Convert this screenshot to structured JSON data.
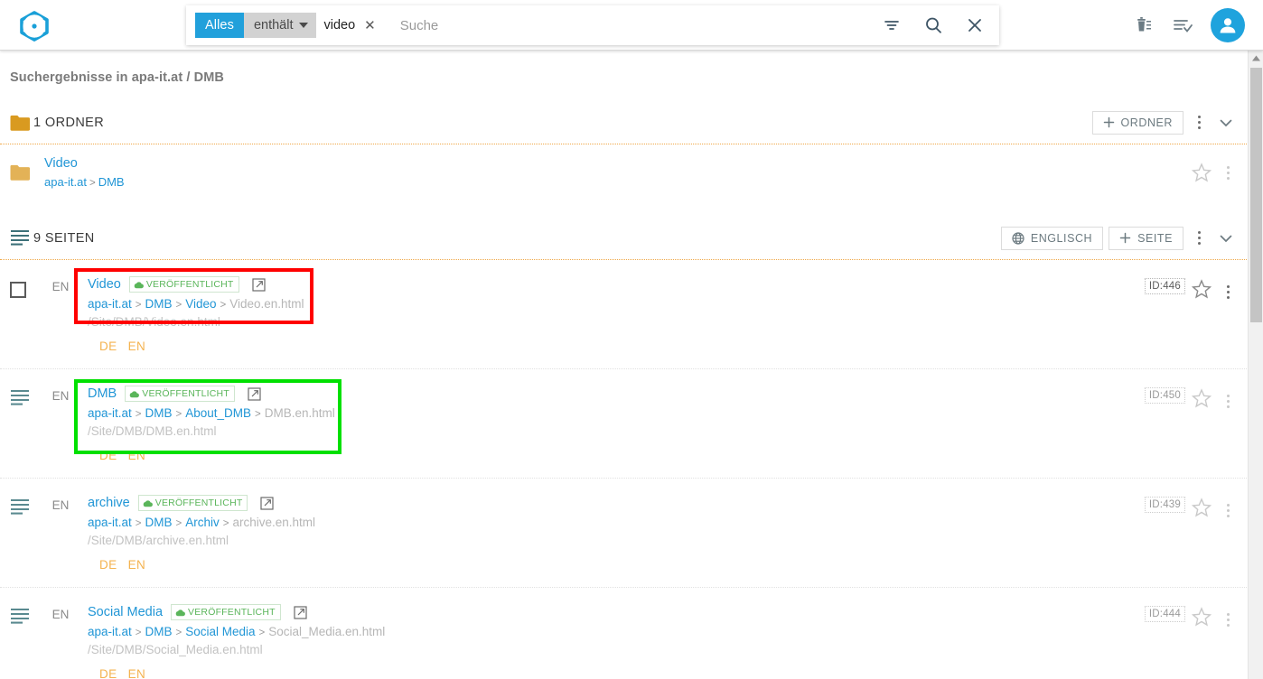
{
  "app": {
    "logo_icon": "hexagon-g-logo",
    "brand_color": "#1aa0d8"
  },
  "search": {
    "chip": {
      "scope_label": "Alles",
      "operator_label": "enthält",
      "operator_caret_icon": "caret-down-icon",
      "value": "video",
      "clear_icon": "close-icon"
    },
    "placeholder": "Suche",
    "value": "",
    "filter_icon": "filter-icon",
    "search_icon": "search-icon",
    "close_icon": "close-icon"
  },
  "topbar_actions": {
    "trash_icon": "trash-list-icon",
    "tasklist_icon": "list-check-icon",
    "avatar_icon": "user-avatar-icon"
  },
  "page": {
    "title": "Suchergebnisse in apa-it.at / DMB"
  },
  "folders_section": {
    "icon": "folder-icon",
    "label": "1 ORDNER",
    "add_button": {
      "icon": "plus-icon",
      "label": "ORDNER"
    },
    "kebab_icon": "more-vertical-icon",
    "collapse_icon": "chevron-down-icon",
    "items": [
      {
        "icon": "folder-icon",
        "name": "Video",
        "path": [
          "apa-it.at",
          "DMB"
        ],
        "star_icon": "star-outline-icon",
        "kebab_icon": "more-vertical-icon"
      }
    ]
  },
  "pages_section": {
    "icon": "page-lines-icon",
    "label": "9 SEITEN",
    "language_button": {
      "icon": "globe-icon",
      "label": "ENGLISCH"
    },
    "add_button": {
      "icon": "plus-icon",
      "label": "SEITE"
    },
    "kebab_icon": "more-vertical-icon",
    "collapse_icon": "chevron-down-icon",
    "status_badge_label": "VERÖFFENTLICHT",
    "status_badge_icon": "cloud-icon",
    "external_link_icon": "open-in-new-icon",
    "items": [
      {
        "lead_icon": "checkbox-icon",
        "selected": false,
        "lang": "EN",
        "title": "Video",
        "status": "VERÖFFENTLICHT",
        "path_links": [
          "apa-it.at",
          "DMB",
          "Video"
        ],
        "path_tail": "Video.en.html",
        "slug": "/Site/DMB/Video.en.html",
        "languages": [
          "DE",
          "EN"
        ],
        "id": "ID:446",
        "star_icon": "star-outline-icon",
        "kebab_icon": "more-vertical-icon"
      },
      {
        "lead_icon": "page-lines-icon",
        "selected": false,
        "lang": "EN",
        "title": "DMB",
        "status": "VERÖFFENTLICHT",
        "path_links": [
          "apa-it.at",
          "DMB",
          "About_DMB"
        ],
        "path_tail": "DMB.en.html",
        "slug": "/Site/DMB/DMB.en.html",
        "languages": [
          "DE",
          "EN"
        ],
        "id": "ID:450",
        "star_icon": "star-outline-icon",
        "kebab_icon": "more-vertical-icon"
      },
      {
        "lead_icon": "page-lines-icon",
        "selected": false,
        "lang": "EN",
        "title": "archive",
        "status": "VERÖFFENTLICHT",
        "path_links": [
          "apa-it.at",
          "DMB",
          "Archiv"
        ],
        "path_tail": "archive.en.html",
        "slug": "/Site/DMB/archive.en.html",
        "languages": [
          "DE",
          "EN"
        ],
        "id": "ID:439",
        "star_icon": "star-outline-icon",
        "kebab_icon": "more-vertical-icon"
      },
      {
        "lead_icon": "page-lines-icon",
        "selected": false,
        "lang": "EN",
        "title": "Social Media",
        "status": "VERÖFFENTLICHT",
        "path_links": [
          "apa-it.at",
          "DMB",
          "Social Media"
        ],
        "path_tail": "Social_Media.en.html",
        "slug": "/Site/DMB/Social_Media.en.html",
        "languages": [
          "DE",
          "EN"
        ],
        "id": "ID:444",
        "star_icon": "star-outline-icon",
        "kebab_icon": "more-vertical-icon"
      }
    ]
  },
  "annotations": [
    {
      "name": "red-highlight-box",
      "color": "#ff0000",
      "target": "result-row-video"
    },
    {
      "name": "green-highlight-box",
      "color": "#00e000",
      "target": "result-row-dmb"
    }
  ],
  "scrollbar": {
    "up_arrow_icon": "caret-up-icon",
    "thumb_name": "vertical-scroll-thumb"
  },
  "colors": {
    "accent_blue": "#2196d6",
    "folder_amber": "#d99a20",
    "folder_amber_light": "#e3b257",
    "published_green": "#5ab55a",
    "lang_orange": "#f4b350",
    "dotted_orange": "#f0a848"
  }
}
